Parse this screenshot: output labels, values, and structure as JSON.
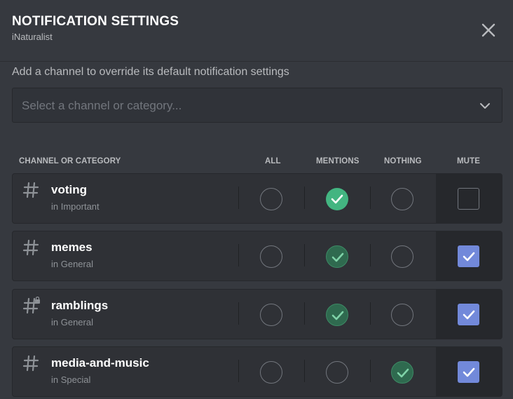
{
  "header": {
    "title": "NOTIFICATION SETTINGS",
    "subtitle": "iNaturalist"
  },
  "help_text": "Add a channel to override its default notification settings",
  "select": {
    "placeholder": "Select a channel or category..."
  },
  "columns": {
    "channel": "CHANNEL OR CATEGORY",
    "all": "ALL",
    "mentions": "MENTIONS",
    "nothing": "NOTHING",
    "mute": "MUTE"
  },
  "rows": [
    {
      "name": "voting",
      "category": "in Important",
      "selected": "mentions",
      "muted": false,
      "locked": false
    },
    {
      "name": "memes",
      "category": "in General",
      "selected": "mentions",
      "muted": true,
      "locked": false
    },
    {
      "name": "ramblings",
      "category": "in General",
      "selected": "mentions",
      "muted": true,
      "locked": true
    },
    {
      "name": "media-and-music",
      "category": "in Special",
      "selected": "nothing",
      "muted": true,
      "locked": false
    }
  ],
  "colors": {
    "background": "#36393f",
    "row": "#2f3136",
    "green": "#43b581",
    "blurple": "#7289da"
  }
}
